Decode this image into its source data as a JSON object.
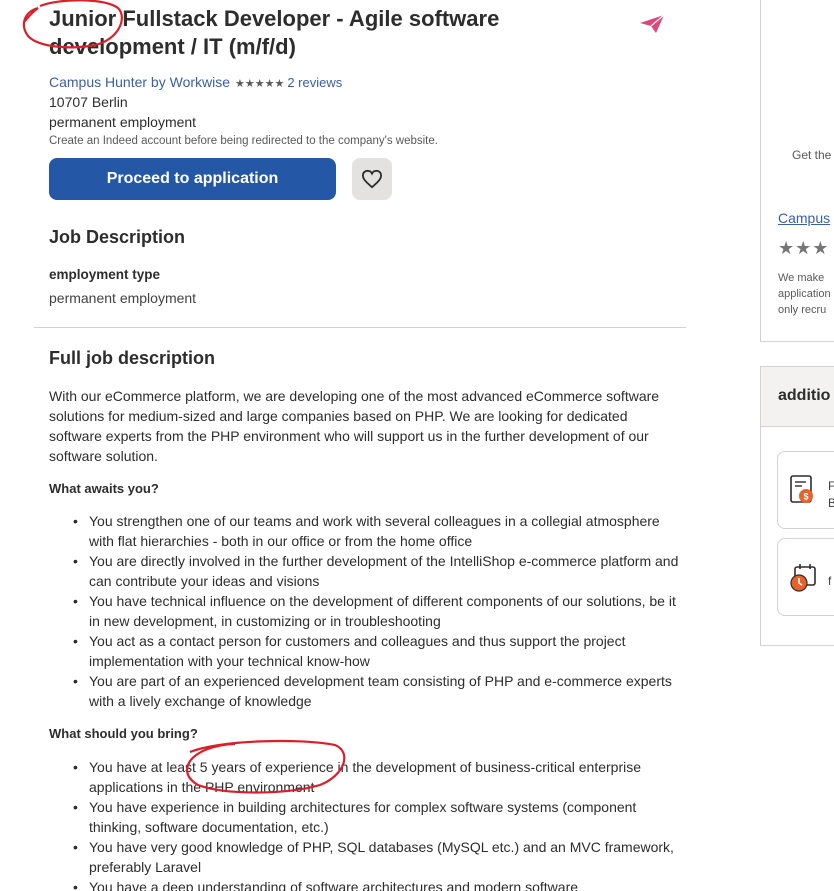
{
  "job": {
    "title": "Junior Fullstack Developer - Agile software development / IT (m/f/d)",
    "company": "Campus Hunter by Workwise",
    "stars": "★★★★★",
    "reviews": "2 reviews",
    "location": "10707 Berlin",
    "employment": "permanent employment",
    "indeed_note": "Create an Indeed account before being redirected to the company's website.",
    "apply_label": "Proceed to application"
  },
  "description": {
    "heading": "Job Description",
    "emp_type_label": "employment type",
    "emp_type_value": "permanent employment",
    "full_heading": "Full job description",
    "intro": "With our eCommerce platform, we are developing one of the most advanced eCommerce software solutions for medium-sized and large companies based on PHP. We are looking for dedicated software experts from the PHP environment who will support us in the further development of our software solution.",
    "awaits_heading": "What awaits you?",
    "awaits": [
      "You strengthen one of our teams and work with several colleagues in a collegial atmosphere with flat hierarchies - both in our office or from the home office",
      "You are directly involved in the further development of the IntelliShop e-commerce platform and can contribute your ideas and visions",
      "You have technical influence on the development of different components of our solutions, be it in new development, in customizing or in troubleshooting",
      "You act as a contact person for customers and colleagues and thus support the project implementation with your technical know-how",
      "You are part of an experienced development team consisting of PHP and e-commerce experts with a lively exchange of knowledge"
    ],
    "bring_heading": "What should you bring?",
    "bring": [
      "You have at least 5 years of experience in the development of business-critical enterprise applications in the PHP environment",
      "You have experience in building architectures for complex software systems (component thinking, software documentation, etc.)",
      "You have very good knowledge of PHP, SQL databases (MySQL etc.) and an MVC framework, preferably Laravel",
      "You have a deep understanding of software architectures and modern software"
    ]
  },
  "side_panel": {
    "get_text": "Get the",
    "company_link": "Campus",
    "stars": "★★★",
    "note_lines": [
      "We make",
      "application",
      "only recru"
    ]
  },
  "additional_panel": {
    "title": "additio",
    "card1_line1": "F",
    "card1_line2": "B",
    "card2_line1": "f"
  },
  "colors": {
    "primary_button": "#2557a7",
    "link": "#3a5fa3",
    "annotation": "#d9202a",
    "share_icon": "#e0457b"
  }
}
